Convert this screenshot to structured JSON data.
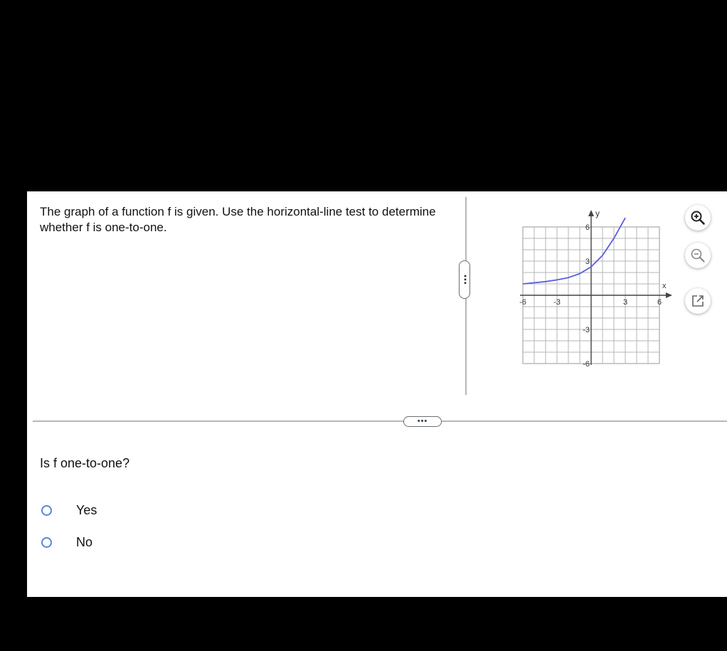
{
  "question": {
    "text": "The graph of a function f is given.  Use the horizontal-line test to determine whether f is one-to-one."
  },
  "graph": {
    "x_axis_label": "x",
    "y_axis_label": "y",
    "x_ticks": [
      "-6",
      "-3",
      "3",
      "6"
    ],
    "y_ticks": [
      "6",
      "3",
      "-3",
      "-6"
    ],
    "curve_color": "#5a5ce0"
  },
  "chart_data": {
    "type": "line",
    "xlabel": "x",
    "ylabel": "y",
    "xlim": [
      -6,
      6
    ],
    "ylim": [
      -6,
      6
    ],
    "grid": true,
    "series": [
      {
        "x": [
          -6,
          -5,
          -4,
          -3,
          -2,
          -1,
          0,
          1,
          2,
          3
        ],
        "y": [
          1.0,
          1.1,
          1.2,
          1.35,
          1.55,
          1.9,
          2.5,
          3.5,
          5.0,
          6.8
        ]
      }
    ]
  },
  "tools": {
    "zoom_in": "zoom-in-icon",
    "zoom_out": "zoom-out-icon",
    "open_new": "open-new-window-icon"
  },
  "prompt": {
    "text": "Is f one-to-one?"
  },
  "options": [
    {
      "label": "Yes"
    },
    {
      "label": "No"
    }
  ],
  "handles": {
    "vertical_dots": "•••",
    "horizontal_dots": "•••"
  }
}
